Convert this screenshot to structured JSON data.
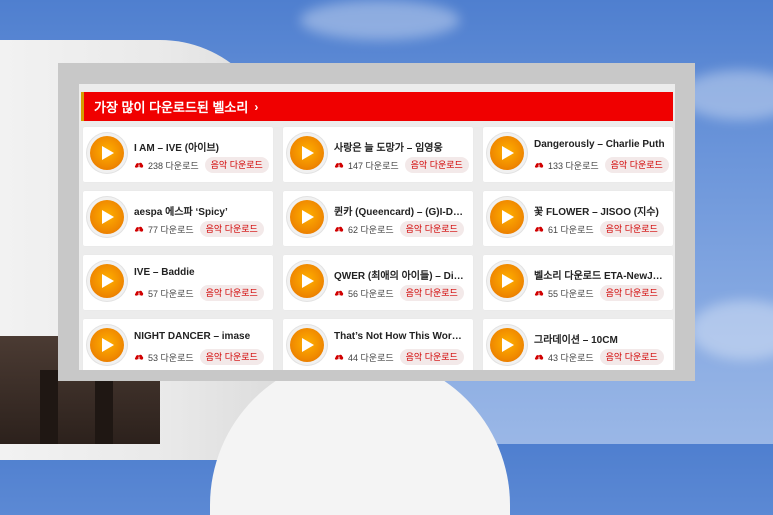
{
  "section": {
    "title": "가장 많이 다운로드된 벨소리",
    "title_arrow": "›"
  },
  "colors": {
    "header_bg": "#f00000",
    "accent_orange": "#f08a00",
    "download_text": "#d10000"
  },
  "items": [
    {
      "title": "I AM – IVE (아이브)",
      "count": "238 다운로드",
      "button": "음악 다운로드"
    },
    {
      "title": "사랑은 늘 도망가 – 임영웅",
      "count": "147 다운로드",
      "button": "음악 다운로드"
    },
    {
      "title": "Dangerously – Charlie Puth",
      "count": "133 다운로드",
      "button": "음악 다운로드"
    },
    {
      "title": "aespa 에스파 ‘Spicy’",
      "count": "77 다운로드",
      "button": "음악 다운로드"
    },
    {
      "title": "퀸카 (Queencard) – (G)I-DLE...",
      "count": "62 다운로드",
      "button": "음악 다운로드"
    },
    {
      "title": "꽃 FLOWER – JISOO (지수)",
      "count": "61 다운로드",
      "button": "음악 다운로드"
    },
    {
      "title": "IVE – Baddie",
      "count": "57 다운로드",
      "button": "음악 다운로드"
    },
    {
      "title": "QWER (최애의 아이들) – Dis...",
      "count": "56 다운로드",
      "button": "음악 다운로드"
    },
    {
      "title": "벨소리 다운로드 ETA-NewJe...",
      "count": "55 다운로드",
      "button": "음악 다운로드"
    },
    {
      "title": "NIGHT DANCER – imase",
      "count": "53 다운로드",
      "button": "음악 다운로드"
    },
    {
      "title": "That’s Not How This Works ...",
      "count": "44 다운로드",
      "button": "음악 다운로드"
    },
    {
      "title": "그라데이션 – 10CM",
      "count": "43 다운로드",
      "button": "음악 다운로드"
    }
  ],
  "icons": {
    "play": "play-icon",
    "download": "cloud-download-icon"
  }
}
